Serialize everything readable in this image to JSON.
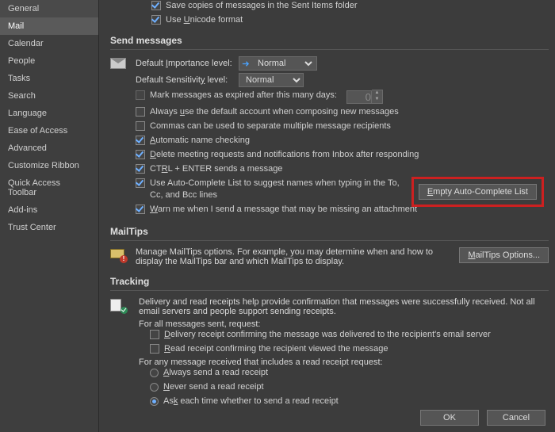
{
  "sidebar": {
    "items": [
      {
        "label": "General"
      },
      {
        "label": "Mail"
      },
      {
        "label": "Calendar"
      },
      {
        "label": "People"
      },
      {
        "label": "Tasks"
      },
      {
        "label": "Search"
      },
      {
        "label": "Language"
      },
      {
        "label": "Ease of Access"
      },
      {
        "label": "Advanced"
      },
      {
        "label": "Customize Ribbon"
      },
      {
        "label": "Quick Access Toolbar"
      },
      {
        "label": "Add-ins"
      },
      {
        "label": "Trust Center"
      }
    ],
    "selected": "Mail"
  },
  "top": {
    "save_copies": "Save copies of messages in the Sent Items folder",
    "unicode": "Use Unicode format"
  },
  "send": {
    "title": "Send messages",
    "importance_label": "Default Importance level:",
    "importance_value": "Normal",
    "sensitivity_label": "Default Sensitivity level:",
    "sensitivity_value": "Normal",
    "expire_label": "Mark messages as expired after this many days:",
    "expire_value": "0",
    "always_default": "Always use the default account when composing new messages",
    "commas": "Commas can be used to separate multiple message recipients",
    "auto_name": "Automatic name checking",
    "delete_meeting": "Delete meeting requests and notifications from Inbox after responding",
    "ctrl_enter": "CTRL + ENTER sends a message",
    "autocomplete": "Use Auto-Complete List to suggest names when typing in the To, Cc, and Bcc lines",
    "empty_btn": "Empty Auto-Complete List",
    "warn_attach": "Warn me when I send a message that may be missing an attachment"
  },
  "mailtips": {
    "title": "MailTips",
    "text": "Manage MailTips options. For example, you may determine when and how to display the MailTips bar and which MailTips to display.",
    "btn": "MailTips Options..."
  },
  "tracking": {
    "title": "Tracking",
    "desc": "Delivery and read receipts help provide confirmation that messages were successfully received. Not all email servers and people support sending receipts.",
    "all_sent": "For all messages sent, request:",
    "delivery_receipt": "Delivery receipt confirming the message was delivered to the recipient's email server",
    "read_receipt": "Read receipt confirming the recipient viewed the message",
    "any_recv": "For any message received that includes a read receipt request:",
    "always_send": "Always send a read receipt",
    "never_send": "Never send a read receipt",
    "ask_each": "Ask each time whether to send a read receipt"
  },
  "footer": {
    "ok": "OK",
    "cancel": "Cancel"
  }
}
